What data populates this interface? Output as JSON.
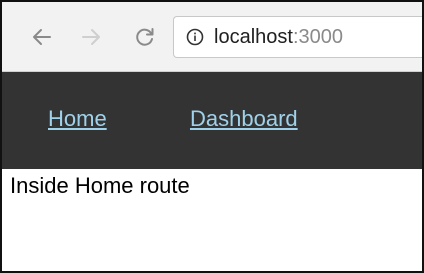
{
  "browser": {
    "url_host": "localhost",
    "url_port": ":3000",
    "icons": {
      "back": "arrow-left",
      "forward": "arrow-right",
      "reload": "reload",
      "info": "circle-info"
    }
  },
  "navbar": {
    "links": [
      {
        "label": "Home"
      },
      {
        "label": "Dashboard"
      }
    ],
    "colors": {
      "background": "#333333",
      "link": "#9fd2ea"
    }
  },
  "page": {
    "text": "Inside Home route"
  }
}
